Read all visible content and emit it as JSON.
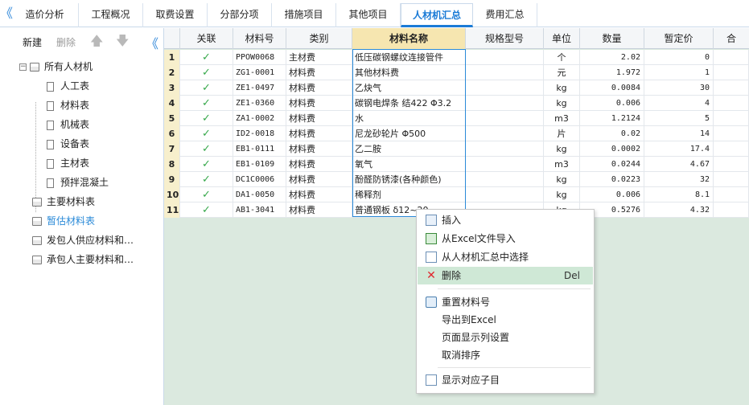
{
  "tabs": {
    "back": "《",
    "items": [
      "造价分析",
      "工程概况",
      "取费设置",
      "分部分项",
      "措施项目",
      "其他项目",
      "人材机汇总",
      "费用汇总"
    ],
    "active_index": 6
  },
  "left_toolbar": {
    "new_label": "新建",
    "delete_label": "删除",
    "up_arrow": "🡅",
    "down_arrow": "🡇",
    "collapse": "《"
  },
  "tree": {
    "root": {
      "expander": "−",
      "label": "所有人材机"
    },
    "children": [
      "人工表",
      "材料表",
      "机械表",
      "设备表",
      "主材表",
      "预拌混凝土"
    ],
    "others": [
      "主要材料表",
      "暂估材料表",
      "发包人供应材料和…",
      "承包人主要材料和…"
    ],
    "selected": "暂估材料表"
  },
  "grid": {
    "columns": [
      "",
      "关联",
      "材料号",
      "类别",
      "材料名称",
      "规格型号",
      "单位",
      "数量",
      "暂定价",
      "合"
    ],
    "check_mark": "✓",
    "rows": [
      {
        "num": "1",
        "code": "PPOW0068",
        "category": "主材费",
        "name": "低压碳钢螺纹连接管件",
        "spec": "",
        "unit": "个",
        "qty": "2.02",
        "price": "0"
      },
      {
        "num": "2",
        "code": "ZG1-0001",
        "category": "材料费",
        "name": "其他材料费",
        "spec": "",
        "unit": "元",
        "qty": "1.972",
        "price": "1"
      },
      {
        "num": "3",
        "code": "ZE1-0497",
        "category": "材料费",
        "name": "乙炔气",
        "spec": "",
        "unit": "kg",
        "qty": "0.0084",
        "price": "30"
      },
      {
        "num": "4",
        "code": "ZE1-0360",
        "category": "材料费",
        "name": "碳钢电焊条 结422 Φ3.2",
        "spec": "",
        "unit": "kg",
        "qty": "0.006",
        "price": "4"
      },
      {
        "num": "5",
        "code": "ZA1-0002",
        "category": "材料费",
        "name": "水",
        "spec": "",
        "unit": "m3",
        "qty": "1.2124",
        "price": "5"
      },
      {
        "num": "6",
        "code": "ID2-0018",
        "category": "材料费",
        "name": "尼龙砂轮片 Φ500",
        "spec": "",
        "unit": "片",
        "qty": "0.02",
        "price": "14"
      },
      {
        "num": "7",
        "code": "EB1-0111",
        "category": "材料费",
        "name": "乙二胺",
        "spec": "",
        "unit": "kg",
        "qty": "0.0002",
        "price": "17.4"
      },
      {
        "num": "8",
        "code": "EB1-0109",
        "category": "材料费",
        "name": "氧气",
        "spec": "",
        "unit": "m3",
        "qty": "0.0244",
        "price": "4.67"
      },
      {
        "num": "9",
        "code": "DC1C0006",
        "category": "材料费",
        "name": "酚醛防锈漆(各种颜色)",
        "spec": "",
        "unit": "kg",
        "qty": "0.0223",
        "price": "32"
      },
      {
        "num": "10",
        "code": "DA1-0050",
        "category": "材料费",
        "name": "稀释剂",
        "spec": "",
        "unit": "kg",
        "qty": "0.006",
        "price": "8.1"
      },
      {
        "num": "11",
        "code": "AB1-3041",
        "category": "材料费",
        "name": "普通钢板 δ12~20",
        "spec": "",
        "unit": "kg",
        "qty": "0.5276",
        "price": "4.32"
      }
    ]
  },
  "context_menu": {
    "items": [
      {
        "icon": "insert-icon",
        "label": "插入",
        "shortcut": ""
      },
      {
        "icon": "excel-import-icon",
        "label": "从Excel文件导入",
        "shortcut": ""
      },
      {
        "icon": "list-select-icon",
        "label": "从人材机汇总中选择",
        "shortcut": ""
      },
      {
        "icon": "delete-x-icon",
        "label": "删除",
        "shortcut": "Del"
      },
      {
        "icon": "renumber-icon",
        "label": "重置材料号",
        "shortcut": ""
      },
      {
        "icon": "",
        "label": "导出到Excel",
        "shortcut": ""
      },
      {
        "icon": "",
        "label": "页面显示列设置",
        "shortcut": ""
      },
      {
        "icon": "",
        "label": "取消排序",
        "shortcut": ""
      },
      {
        "icon": "show-subitem-icon",
        "label": "显示对应子目",
        "shortcut": ""
      }
    ],
    "hover_index": 3
  },
  "colors": {
    "accent": "#1b7bd6",
    "grid_bg": "#dbe9df",
    "check": "#36a84a",
    "delete_icon": "#e0282e",
    "menu_hover": "#cfe8d6"
  }
}
